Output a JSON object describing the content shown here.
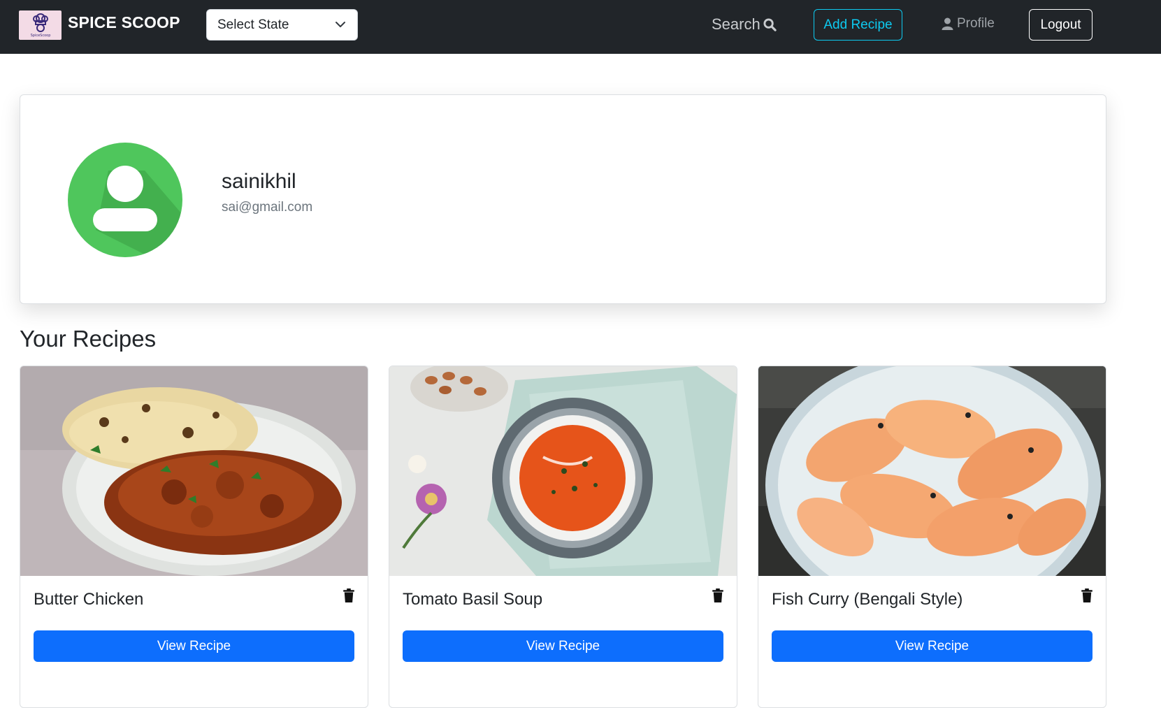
{
  "nav": {
    "brand": "SPICE SCOOP",
    "logo_text": "SpiceScoop",
    "state_select": "Select State",
    "search": "Search",
    "add_recipe": "Add Recipe",
    "profile": "Profile",
    "logout": "Logout"
  },
  "profile": {
    "username": "sainikhil",
    "email": "sai@gmail.com"
  },
  "section": {
    "title": "Your Recipes"
  },
  "recipes": [
    {
      "title": "Butter Chicken",
      "button": "View Recipe"
    },
    {
      "title": "Tomato Basil Soup",
      "button": "View Recipe"
    },
    {
      "title": "Fish Curry (Bengali Style)",
      "button": "View Recipe"
    }
  ],
  "colors": {
    "navbar": "#212529",
    "primary": "#0d6efd",
    "info": "#0dcaf0",
    "avatar": "#4fc65c"
  }
}
